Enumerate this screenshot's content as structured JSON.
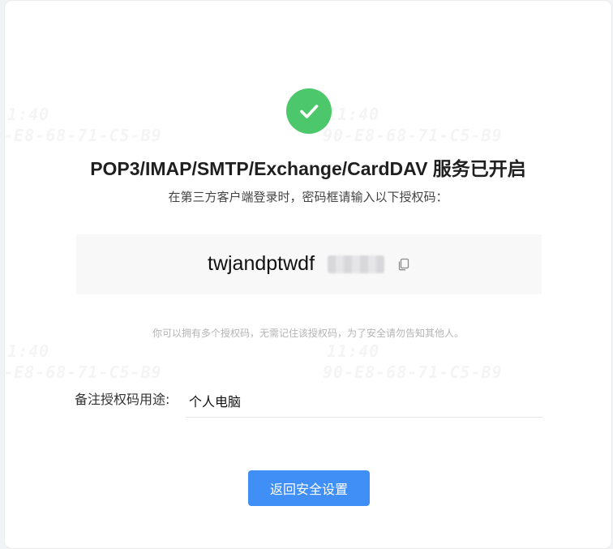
{
  "service": {
    "title": "POP3/IMAP/SMTP/Exchange/CardDAV 服务已开启",
    "subtitle": "在第三方客户端登录时，密码框请输入以下授权码："
  },
  "auth_code": {
    "visible_text": "twjandptwdf",
    "masked": true
  },
  "hint": "你可以拥有多个授权码，无需记住该授权码，为了安全请勿告知其他人。",
  "remark": {
    "label": "备注授权码用途:",
    "value": "个人电脑"
  },
  "back_button": {
    "label": "返回安全设置"
  },
  "watermark": {
    "time": "11:40",
    "mac": "90-E8-68-71-C5-B9"
  },
  "colors": {
    "success": "#4cc76b",
    "primary": "#3f8ff7"
  }
}
